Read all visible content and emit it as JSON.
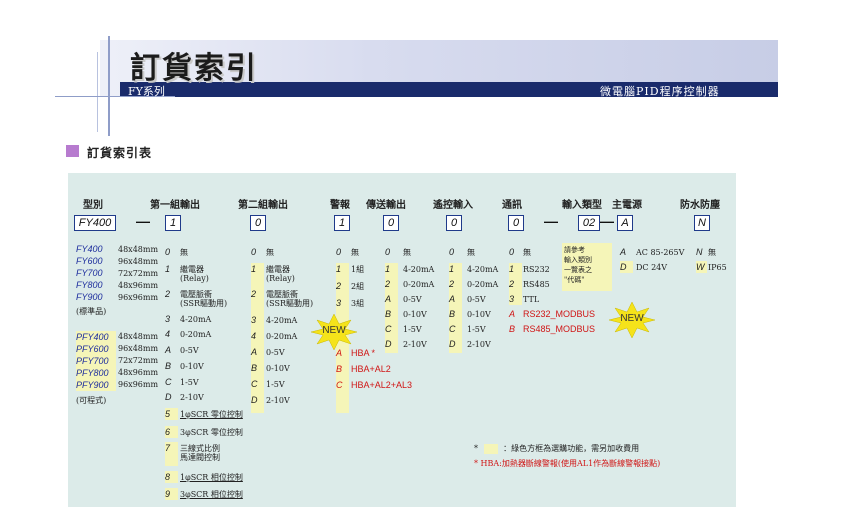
{
  "header": {
    "title": "訂貨索引",
    "sub_left": "FY系列",
    "sub_right": "微電腦PID程序控制器"
  },
  "section_title": "訂貨索引表",
  "columns": {
    "model": "型別",
    "out1": "第一組輸出",
    "out2": "第二組輸出",
    "alarm": "警報",
    "retrans": "傳送輸出",
    "remote": "遙控輸入",
    "comm": "通訊",
    "input": "輸入類型",
    "power": "主電源",
    "water": "防水防塵"
  },
  "code_boxes": {
    "model": "FY400",
    "out1": "1",
    "out2": "0",
    "alarm": "1",
    "retrans": "0",
    "remote": "0",
    "comm": "0",
    "input": "02",
    "power": "A",
    "water": "N",
    "dash": "—"
  },
  "models": {
    "standard": [
      {
        "code": "FY400",
        "size": "48x48mm"
      },
      {
        "code": "FY600",
        "size": "96x48mm"
      },
      {
        "code": "FY700",
        "size": "72x72mm"
      },
      {
        "code": "FY800",
        "size": "48x96mm"
      },
      {
        "code": "FY900",
        "size": "96x96mm"
      }
    ],
    "standard_label": "(標準品)",
    "programmable": [
      {
        "code": "PFY400",
        "size": "48x48mm"
      },
      {
        "code": "PFY600",
        "size": "96x48mm"
      },
      {
        "code": "PFY700",
        "size": "72x72mm"
      },
      {
        "code": "PFY800",
        "size": "48x96mm"
      },
      {
        "code": "PFY900",
        "size": "96x96mm"
      }
    ],
    "programmable_label": "(可程式)"
  },
  "output1": [
    {
      "code": "0",
      "text": "無"
    },
    {
      "code": "1",
      "text": "繼電器"
    },
    {
      "code": "",
      "text": "(Relay)"
    },
    {
      "code": "2",
      "text": "電壓脈衝"
    },
    {
      "code": "",
      "text": "(SSR驅動用)"
    },
    {
      "code": "3",
      "text": "4-20mA"
    },
    {
      "code": "4",
      "text": "0-20mA"
    },
    {
      "code": "A",
      "text": "0-5V"
    },
    {
      "code": "B",
      "text": "0-10V"
    },
    {
      "code": "C",
      "text": "1-5V"
    },
    {
      "code": "D",
      "text": "2-10V"
    },
    {
      "code": "5",
      "text": "1φSCR 零位控制"
    },
    {
      "code": "6",
      "text": "3φSCR 零位控制"
    },
    {
      "code": "7",
      "text": "三線式比例"
    },
    {
      "code": "",
      "text": "馬達閥控制"
    },
    {
      "code": "8",
      "text": "1φSCR 相位控制"
    },
    {
      "code": "9",
      "text": "3φSCR 相位控制"
    }
  ],
  "output2": [
    {
      "code": "0",
      "text": "無"
    },
    {
      "code": "1",
      "text": "繼電器"
    },
    {
      "code": "",
      "text": "(Relay)"
    },
    {
      "code": "2",
      "text": "電壓脈衝"
    },
    {
      "code": "",
      "text": "(SSR驅動用)"
    },
    {
      "code": "3",
      "text": "4-20mA"
    },
    {
      "code": "4",
      "text": "0-20mA"
    },
    {
      "code": "A",
      "text": "0-5V"
    },
    {
      "code": "B",
      "text": "0-10V"
    },
    {
      "code": "C",
      "text": "1-5V"
    },
    {
      "code": "D",
      "text": "2-10V"
    }
  ],
  "alarm": [
    {
      "code": "0",
      "text": "無"
    },
    {
      "code": "1",
      "text": "1組"
    },
    {
      "code": "2",
      "text": "2組"
    },
    {
      "code": "3",
      "text": "3組"
    }
  ],
  "alarm_hba": [
    {
      "code": "A",
      "text": "HBA *"
    },
    {
      "code": "B",
      "text": "HBA+AL2"
    },
    {
      "code": "C",
      "text": "HBA+AL2+AL3"
    }
  ],
  "retrans": [
    {
      "code": "0",
      "text": "無"
    },
    {
      "code": "1",
      "text": "4-20mA"
    },
    {
      "code": "2",
      "text": "0-20mA"
    },
    {
      "code": "A",
      "text": "0-5V"
    },
    {
      "code": "B",
      "text": "0-10V"
    },
    {
      "code": "C",
      "text": "1-5V"
    },
    {
      "code": "D",
      "text": "2-10V"
    }
  ],
  "remote": [
    {
      "code": "0",
      "text": "無"
    },
    {
      "code": "1",
      "text": "4-20mA"
    },
    {
      "code": "2",
      "text": "0-20mA"
    },
    {
      "code": "A",
      "text": "0-5V"
    },
    {
      "code": "B",
      "text": "0-10V"
    },
    {
      "code": "C",
      "text": "1-5V"
    },
    {
      "code": "D",
      "text": "2-10V"
    }
  ],
  "comm": [
    {
      "code": "0",
      "text": "無"
    },
    {
      "code": "1",
      "text": "RS232"
    },
    {
      "code": "2",
      "text": "RS485"
    },
    {
      "code": "3",
      "text": "TTL"
    }
  ],
  "comm_modbus": [
    {
      "code": "A",
      "text": "RS232_MODBUS"
    },
    {
      "code": "B",
      "text": "RS485_MODBUS"
    }
  ],
  "input_note": [
    "請參考",
    "輸入類別",
    "一覽表之",
    "\"代碼\""
  ],
  "power": [
    {
      "code": "A",
      "text": "AC 85-265V"
    },
    {
      "code": "D",
      "text": "DC 24V"
    }
  ],
  "water": [
    {
      "code": "N",
      "text": "無"
    },
    {
      "code": "W",
      "text": "IP65"
    }
  ],
  "badge": "NEW",
  "notes": {
    "star1": "*",
    "green": "：綠色方框為選購功能，需另加收費用",
    "hba": "* HBA:加熱器斷線警報(使用AL1作為斷線警報接點)"
  },
  "colors": {
    "panel": "#dcebe9",
    "option_highlight": "#f5f5b8",
    "code_blue": "#1f2f9e",
    "red": "#d01515",
    "banner_strip": "#1a2b6b",
    "new_badge": "#f5e31a"
  }
}
